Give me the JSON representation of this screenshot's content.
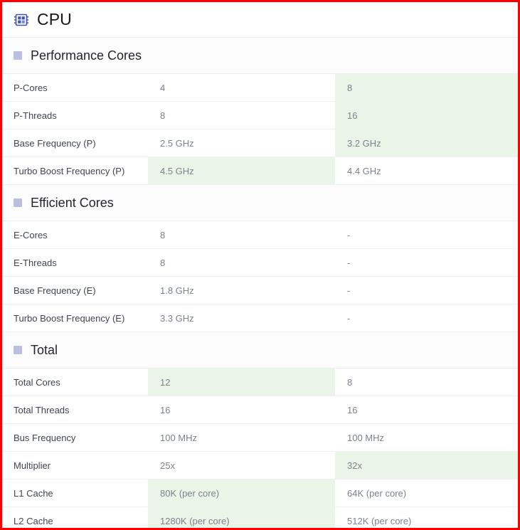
{
  "header": {
    "title": "CPU",
    "icon": "cpu-chip-icon"
  },
  "colors": {
    "border_accent": "#ff0000",
    "highlight_green": "#e9f5e6",
    "section_marker": "#bcc0e0",
    "icon_blue": "#3f51b5",
    "label_text": "#3f4550",
    "value_text": "#7b8290"
  },
  "sections": [
    {
      "title": "Performance Cores",
      "marker": "section-square-marker",
      "rows": [
        {
          "label": "P-Cores",
          "col1": "4",
          "col1_highlight": false,
          "col2": "8",
          "col2_highlight": true
        },
        {
          "label": "P-Threads",
          "col1": "8",
          "col1_highlight": false,
          "col2": "16",
          "col2_highlight": true
        },
        {
          "label": "Base Frequency (P)",
          "col1": "2.5 GHz",
          "col1_highlight": false,
          "col2": "3.2 GHz",
          "col2_highlight": true
        },
        {
          "label": "Turbo Boost Frequency (P)",
          "col1": "4.5 GHz",
          "col1_highlight": true,
          "col2": "4.4 GHz",
          "col2_highlight": false
        }
      ]
    },
    {
      "title": "Efficient Cores",
      "marker": "section-square-marker",
      "rows": [
        {
          "label": "E-Cores",
          "col1": "8",
          "col1_highlight": false,
          "col2": "-",
          "col2_highlight": false
        },
        {
          "label": "E-Threads",
          "col1": "8",
          "col1_highlight": false,
          "col2": "-",
          "col2_highlight": false
        },
        {
          "label": "Base Frequency (E)",
          "col1": "1.8 GHz",
          "col1_highlight": false,
          "col2": "-",
          "col2_highlight": false
        },
        {
          "label": "Turbo Boost Frequency (E)",
          "col1": "3.3 GHz",
          "col1_highlight": false,
          "col2": "-",
          "col2_highlight": false
        }
      ]
    },
    {
      "title": "Total",
      "marker": "section-square-marker",
      "rows": [
        {
          "label": "Total Cores",
          "col1": "12",
          "col1_highlight": true,
          "col2": "8",
          "col2_highlight": false
        },
        {
          "label": "Total Threads",
          "col1": "16",
          "col1_highlight": false,
          "col2": "16",
          "col2_highlight": false
        },
        {
          "label": "Bus Frequency",
          "col1": "100 MHz",
          "col1_highlight": false,
          "col2": "100 MHz",
          "col2_highlight": false
        },
        {
          "label": "Multiplier",
          "col1": "25x",
          "col1_highlight": false,
          "col2": "32x",
          "col2_highlight": true
        },
        {
          "label": "L1 Cache",
          "col1": "80K (per core)",
          "col1_highlight": true,
          "col2": "64K (per core)",
          "col2_highlight": false
        },
        {
          "label": "L2 Cache",
          "col1": "1280K (per core)",
          "col1_highlight": true,
          "col2": "512K (per core)",
          "col2_highlight": false
        }
      ]
    }
  ]
}
